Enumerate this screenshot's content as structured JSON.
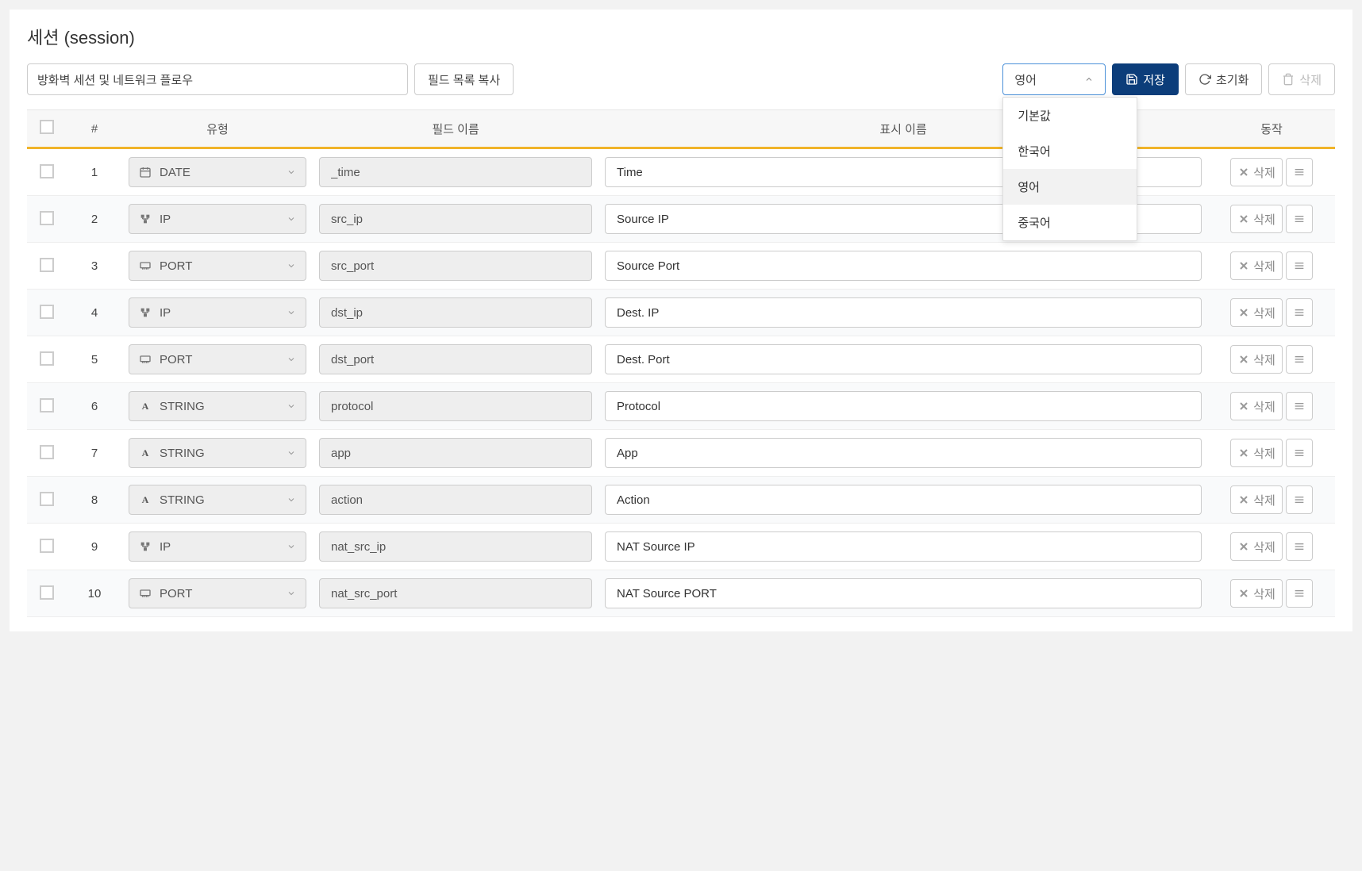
{
  "title": "세션 (session)",
  "toolbar": {
    "description": "방화벽 세션 및 네트워크 플로우",
    "copy_fields": "필드 목록 복사",
    "language_selected": "영어",
    "language_options": [
      "기본값",
      "한국어",
      "영어",
      "중국어"
    ],
    "save": "저장",
    "reset": "초기화",
    "delete": "삭제"
  },
  "columns": {
    "num": "#",
    "type": "유형",
    "field": "필드 이름",
    "display": "표시 이름",
    "action": "동작"
  },
  "row_delete_label": "삭제",
  "field_types": {
    "DATE": "DATE",
    "IP": "IP",
    "PORT": "PORT",
    "STRING": "STRING"
  },
  "rows": [
    {
      "num": "1",
      "type": "DATE",
      "field": "_time",
      "display": "Time"
    },
    {
      "num": "2",
      "type": "IP",
      "field": "src_ip",
      "display": "Source IP"
    },
    {
      "num": "3",
      "type": "PORT",
      "field": "src_port",
      "display": "Source Port"
    },
    {
      "num": "4",
      "type": "IP",
      "field": "dst_ip",
      "display": "Dest. IP"
    },
    {
      "num": "5",
      "type": "PORT",
      "field": "dst_port",
      "display": "Dest. Port"
    },
    {
      "num": "6",
      "type": "STRING",
      "field": "protocol",
      "display": "Protocol"
    },
    {
      "num": "7",
      "type": "STRING",
      "field": "app",
      "display": "App"
    },
    {
      "num": "8",
      "type": "STRING",
      "field": "action",
      "display": "Action"
    },
    {
      "num": "9",
      "type": "IP",
      "field": "nat_src_ip",
      "display": "NAT Source IP"
    },
    {
      "num": "10",
      "type": "PORT",
      "field": "nat_src_port",
      "display": "NAT Source PORT"
    }
  ]
}
